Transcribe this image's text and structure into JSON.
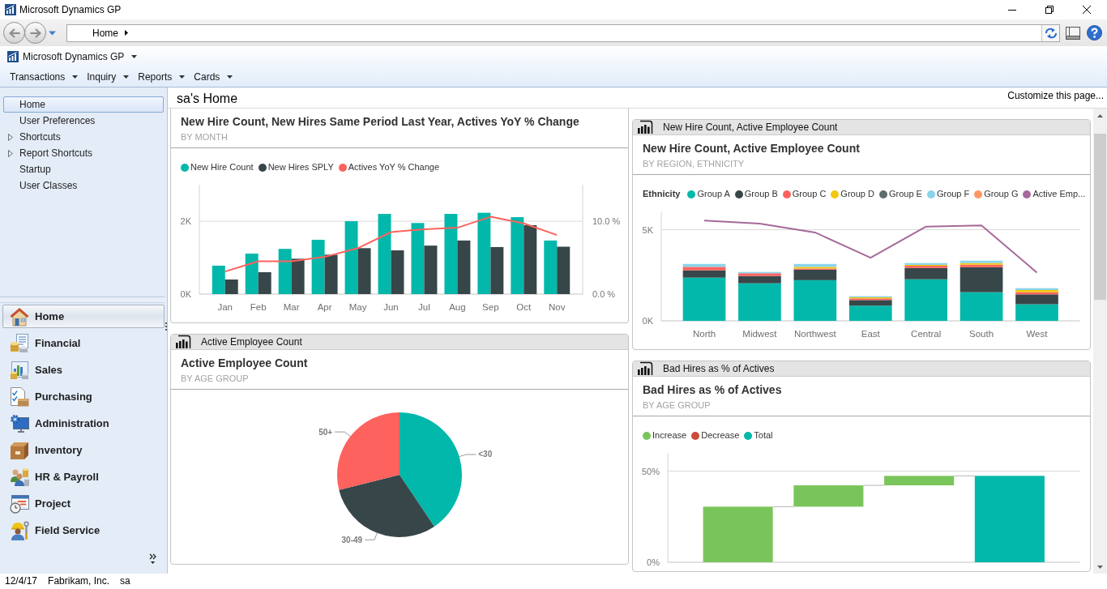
{
  "window": {
    "title": "Microsoft Dynamics GP"
  },
  "navigation_bar": {
    "breadcrumb": "Home"
  },
  "menu_bar": {
    "app_menu": "Microsoft Dynamics GP",
    "menus": [
      "Transactions",
      "Inquiry",
      "Reports",
      "Cards"
    ]
  },
  "sidebar": {
    "tree_items": [
      {
        "label": "Home",
        "selected": true,
        "expandable": false
      },
      {
        "label": "User Preferences",
        "selected": false,
        "expandable": false
      },
      {
        "label": "Shortcuts",
        "selected": false,
        "expandable": true
      },
      {
        "label": "Report Shortcuts",
        "selected": false,
        "expandable": true
      },
      {
        "label": "Startup",
        "selected": false,
        "expandable": false
      },
      {
        "label": "User Classes",
        "selected": false,
        "expandable": false
      }
    ],
    "nav_buttons": [
      {
        "label": "Home",
        "selected": true
      },
      {
        "label": "Financial",
        "selected": false
      },
      {
        "label": "Sales",
        "selected": false
      },
      {
        "label": "Purchasing",
        "selected": false
      },
      {
        "label": "Administration",
        "selected": false
      },
      {
        "label": "Inventory",
        "selected": false
      },
      {
        "label": "HR & Payroll",
        "selected": false
      },
      {
        "label": "Project",
        "selected": false
      },
      {
        "label": "Field Service",
        "selected": false
      }
    ]
  },
  "page": {
    "title": "sa's Home",
    "customize_link": "Customize this page...",
    "columns": [
      {
        "panels": [
          {
            "chart_data": {
              "type": "bar",
              "title": "New Hire Count, New Hires Same Period Last Year, Actives YoY % Change",
              "subtitle": "BY MONTH",
              "legend": "top",
              "grid": true,
              "categories": [
                "Jan",
                "Feb",
                "Mar",
                "Apr",
                "May",
                "Jun",
                "Jul",
                "Aug",
                "Sep",
                "Oct",
                "Nov"
              ],
              "series": [
                {
                  "name": "New Hire Count",
                  "color": "#01b8aa",
                  "values": [
                    780,
                    1110,
                    1240,
                    1490,
                    2000,
                    2200,
                    1950,
                    2200,
                    2230,
                    2110,
                    1470
                  ]
                },
                {
                  "name": "New Hires SPLY",
                  "color": "#374649",
                  "values": [
                    400,
                    600,
                    970,
                    1080,
                    1260,
                    1200,
                    1330,
                    1470,
                    1290,
                    1890,
                    1300
                  ]
                },
                {
                  "name": "Actives YoY % Change",
                  "type": "line",
                  "axis": "y2",
                  "color": "#fd625e",
                  "values": [
                    3.1,
                    4.5,
                    4.5,
                    5.1,
                    6.3,
                    8.5,
                    8.9,
                    9.1,
                    10.6,
                    9.7,
                    8.1
                  ]
                }
              ],
              "ylim": [
                0,
                3000
              ],
              "yticks": [
                {
                  "value": 0,
                  "label": "0K"
                },
                {
                  "value": 2000,
                  "label": "2K"
                }
              ],
              "y2lim": [
                0,
                15
              ],
              "y2ticks": [
                {
                  "value": 0,
                  "label": "0.0 %"
                },
                {
                  "value": 10,
                  "label": "10.0 %"
                }
              ]
            }
          },
          {
            "header": "Active Employee Count",
            "chart_data": {
              "type": "pie",
              "title": "Active Employee Count",
              "subtitle": "BY AGE GROUP",
              "categories": [
                "<30",
                "30-49",
                "50+"
              ],
              "values": [
                40.6,
                30.5,
                28.9
              ],
              "colors": [
                "#01b8aa",
                "#374649",
                "#fd625e"
              ]
            }
          }
        ]
      },
      {
        "panels": [
          {
            "header": "New Hire Count, Active Employee Count",
            "chart_data": {
              "type": "bar",
              "stacked": true,
              "title": "New Hire Count, Active Employee Count",
              "subtitle": "BY REGION, ETHNICITY",
              "legend": "top",
              "legend_title": "Ethnicity",
              "grid": true,
              "categories": [
                "North",
                "Midwest",
                "Northwest",
                "East",
                "Central",
                "South",
                "West"
              ],
              "series": [
                {
                  "name": "Group A",
                  "color": "#01b8aa",
                  "values": [
                    2370,
                    2060,
                    2230,
                    830,
                    2280,
                    1570,
                    910
                  ]
                },
                {
                  "name": "Group B",
                  "color": "#374649",
                  "values": [
                    400,
                    400,
                    580,
                    310,
                    620,
                    1370,
                    540
                  ]
                },
                {
                  "name": "Group C",
                  "color": "#fd625e",
                  "values": [
                    190,
                    150,
                    60,
                    90,
                    120,
                    140,
                    120
                  ]
                },
                {
                  "name": "Group D",
                  "color": "#f2c80f",
                  "values": [
                    0,
                    0,
                    90,
                    60,
                    50,
                    90,
                    120
                  ]
                },
                {
                  "name": "Group E",
                  "color": "#5f6b6d",
                  "values": [
                    0,
                    0,
                    0,
                    0,
                    0,
                    0,
                    0
                  ]
                },
                {
                  "name": "Group F",
                  "color": "#8ad4eb",
                  "values": [
                    160,
                    70,
                    160,
                    60,
                    100,
                    130,
                    100
                  ]
                },
                {
                  "name": "Group G",
                  "color": "#fe9666",
                  "values": [
                    0,
                    0,
                    0,
                    0,
                    0,
                    0,
                    0
                  ]
                },
                {
                  "name": "Active Emp...",
                  "type": "line",
                  "color": "#a66999",
                  "values": [
                    5500,
                    5330,
                    4850,
                    3460,
                    5170,
                    5230,
                    2650
                  ]
                }
              ],
              "ylim": [
                0,
                6000
              ],
              "yticks": [
                {
                  "value": 0,
                  "label": "0K"
                },
                {
                  "value": 5000,
                  "label": "5K"
                }
              ]
            }
          },
          {
            "header": "Bad Hires as % of Actives",
            "chart_data": {
              "type": "bar",
              "title": "Bad Hires as % of Actives",
              "subtitle": "BY AGE GROUP",
              "legend": "top",
              "grid": true,
              "categories": [
                null,
                null,
                null,
                null
              ],
              "series": [
                {
                  "name": "Increase",
                  "color": "#7ac55b",
                  "values": [
                    30.5,
                    11.7,
                    5.2,
                    null
                  ],
                  "base": [
                    0,
                    30.5,
                    42.2,
                    null
                  ]
                },
                {
                  "name": "Decrease",
                  "color": "#cc4b3b",
                  "values": [
                    null,
                    null,
                    null,
                    null
                  ]
                },
                {
                  "name": "Total",
                  "color": "#01b8aa",
                  "values": [
                    null,
                    null,
                    null,
                    47.4
                  ],
                  "base": [
                    null,
                    null,
                    null,
                    0
                  ]
                }
              ],
              "ylim": [
                0,
                60
              ],
              "yticks": [
                {
                  "value": 0,
                  "label": "0%"
                },
                {
                  "value": 50,
                  "label": "50%"
                }
              ]
            }
          }
        ]
      }
    ]
  },
  "status_bar": {
    "date": "12/4/17",
    "company": "Fabrikam, Inc.",
    "user": "sa"
  }
}
